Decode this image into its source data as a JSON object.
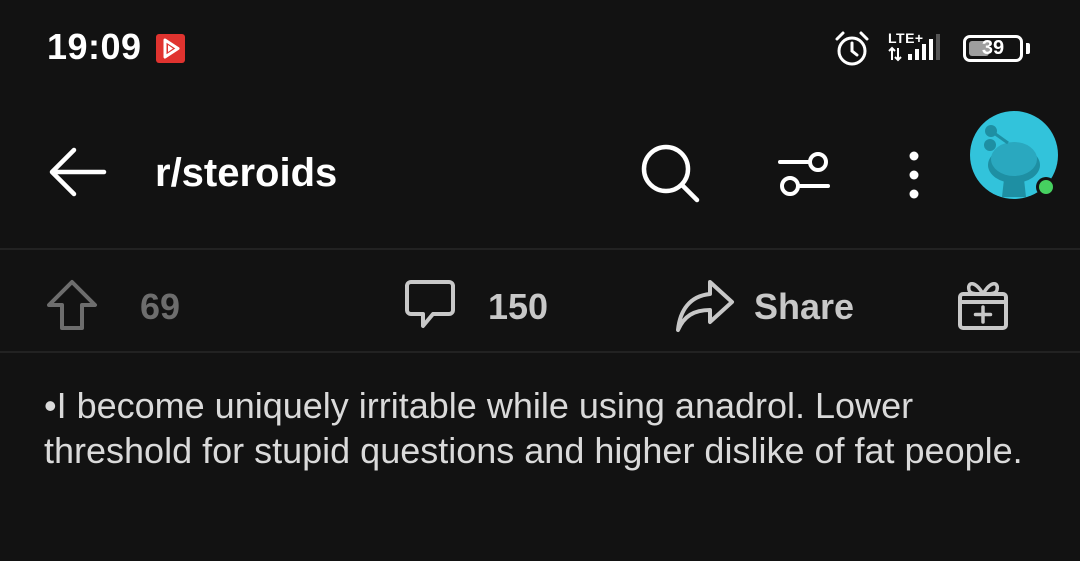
{
  "status_bar": {
    "time": "19:09",
    "network_label": "LTE+",
    "battery_level": "39",
    "icons": [
      "youtube-music-icon",
      "alarm-icon",
      "signal-icon",
      "battery-icon"
    ]
  },
  "header": {
    "subreddit": "r/steroids",
    "icons": [
      "back-arrow-icon",
      "search-icon",
      "filter-icon",
      "more-vertical-icon",
      "avatar"
    ]
  },
  "actions": {
    "upvotes": "69",
    "comments": "150",
    "share_label": "Share",
    "icons": [
      "upvote-arrow-icon",
      "comment-icon",
      "share-icon",
      "gift-award-icon"
    ]
  },
  "post": {
    "body": "•I become uniquely irritable while using anadrol. Lower threshold for stupid questions and higher dislike of fat people."
  },
  "colors": {
    "background": "#121212",
    "text": "#dadada",
    "avatar_bg": "#32c3db",
    "online_dot": "#46d160",
    "app_icon": "#e0332f"
  }
}
